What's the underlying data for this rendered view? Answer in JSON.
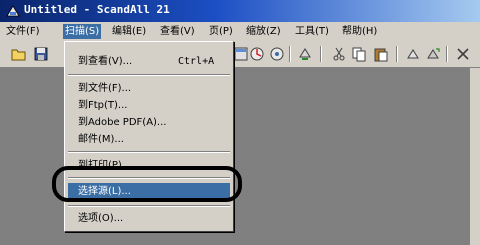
{
  "window": {
    "title": "Untitled - ScandAll 21",
    "icon": "scanner-app-icon"
  },
  "menubar": {
    "items": [
      {
        "label": "文件(F)",
        "name": "file"
      },
      {
        "label": "扫描(S)",
        "name": "scan",
        "active": true
      },
      {
        "label": "编辑(E)",
        "name": "edit"
      },
      {
        "label": "查看(V)",
        "name": "view"
      },
      {
        "label": "页(P)",
        "name": "page"
      },
      {
        "label": "缩放(Z)",
        "name": "zoom"
      },
      {
        "label": "工具(T)",
        "name": "tools"
      },
      {
        "label": "帮助(H)",
        "name": "help"
      }
    ]
  },
  "toolbar": {
    "icons": [
      "open-folder-icon",
      "save-icon",
      "scan-icon",
      "scan-setting-icon",
      "settings-icon",
      "cut-icon",
      "copy-icon",
      "paste-icon",
      "rotate-icon",
      "rotate-right-icon",
      "delete-icon"
    ]
  },
  "scan_menu": {
    "items": [
      {
        "label": "到查看(V)...",
        "shortcut": "Ctrl+A"
      },
      {
        "label": "到文件(F)..."
      },
      {
        "label": "到Ftp(T)..."
      },
      {
        "label": "到Adobe PDF(A)..."
      },
      {
        "label": "邮件(M)..."
      },
      {
        "label": "到打印(P)..."
      },
      {
        "label": "选择源(L)...",
        "highlighted": true
      },
      {
        "label": "选项(O)..."
      }
    ]
  },
  "colors": {
    "menu_highlight": "#3a6ea5",
    "title_gradient_start": "#0a246a",
    "workspace": "#808080",
    "chrome": "#d4d0c8"
  }
}
